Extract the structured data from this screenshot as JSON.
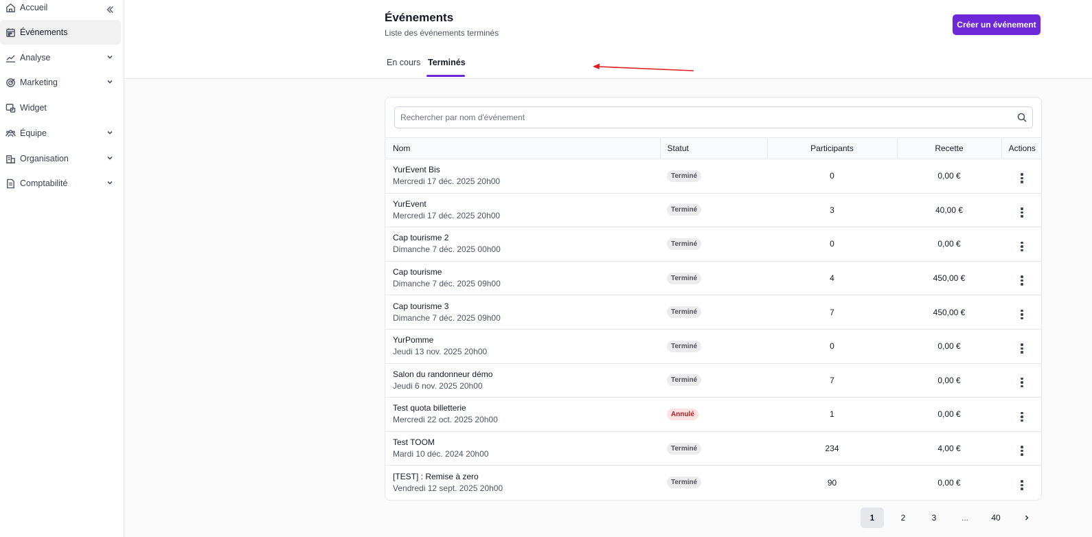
{
  "sidebar": {
    "items": [
      {
        "label": "Accueil",
        "icon": "home-icon",
        "expandable": false,
        "active": false
      },
      {
        "label": "Événements",
        "icon": "calendar-icon",
        "expandable": false,
        "active": true
      },
      {
        "label": "Analyse",
        "icon": "chart-line-icon",
        "expandable": true,
        "active": false
      },
      {
        "label": "Marketing",
        "icon": "target-icon",
        "expandable": true,
        "active": false
      },
      {
        "label": "Widget",
        "icon": "widget-icon",
        "expandable": false,
        "active": false
      },
      {
        "label": "Équipe",
        "icon": "team-icon",
        "expandable": true,
        "active": false
      },
      {
        "label": "Organisation",
        "icon": "building-icon",
        "expandable": true,
        "active": false
      },
      {
        "label": "Comptabilité",
        "icon": "document-icon",
        "expandable": true,
        "active": false
      }
    ]
  },
  "header": {
    "title": "Événements",
    "subtitle": "Liste des événements terminés",
    "create_button": "Créer un événement",
    "tabs": [
      {
        "label": "En cours",
        "active": false
      },
      {
        "label": "Terminés",
        "active": true
      }
    ]
  },
  "search": {
    "placeholder": "Rechercher par nom d'événement",
    "value": ""
  },
  "table": {
    "columns": [
      "Nom",
      "Statut",
      "Participants",
      "Recette",
      "Actions"
    ],
    "rows": [
      {
        "name": "YurEvent Bis",
        "date": "Mercredi 17 déc. 2025 20h00",
        "status": "Terminé",
        "participants": "0",
        "revenue": "0,00 €"
      },
      {
        "name": "YurEvent",
        "date": "Mercredi 17 déc. 2025 20h00",
        "status": "Terminé",
        "participants": "3",
        "revenue": "40,00 €"
      },
      {
        "name": "Cap tourisme 2",
        "date": "Dimanche 7 déc. 2025 00h00",
        "status": "Terminé",
        "participants": "0",
        "revenue": "0,00 €"
      },
      {
        "name": "Cap tourisme",
        "date": "Dimanche 7 déc. 2025 09h00",
        "status": "Terminé",
        "participants": "4",
        "revenue": "450,00 €"
      },
      {
        "name": "Cap tourisme 3",
        "date": "Dimanche 7 déc. 2025 09h00",
        "status": "Terminé",
        "participants": "7",
        "revenue": "450,00 €"
      },
      {
        "name": "YurPomme",
        "date": "Jeudi 13 nov. 2025 20h00",
        "status": "Terminé",
        "participants": "0",
        "revenue": "0,00 €"
      },
      {
        "name": "Salon du randonneur démo",
        "date": "Jeudi 6 nov. 2025 20h00",
        "status": "Terminé",
        "participants": "7",
        "revenue": "0,00 €"
      },
      {
        "name": "Test quota billetterie",
        "date": "Mercredi 22 oct. 2025 20h00",
        "status": "Annulé",
        "participants": "1",
        "revenue": "0,00 €"
      },
      {
        "name": "Test TOOM",
        "date": "Mardi 10 déc. 2024 20h00",
        "status": "Terminé",
        "participants": "234",
        "revenue": "4,00 €"
      },
      {
        "name": "[TEST] : Remise à zero",
        "date": "Vendredi 12 sept. 2025 20h00",
        "status": "Terminé",
        "participants": "90",
        "revenue": "0,00 €"
      }
    ]
  },
  "pagination": {
    "pages": [
      "1",
      "2",
      "3",
      "...",
      "40"
    ],
    "current": "1"
  },
  "colors": {
    "accent": "#6d28d9",
    "annotation_arrow": "#e11d1d"
  }
}
